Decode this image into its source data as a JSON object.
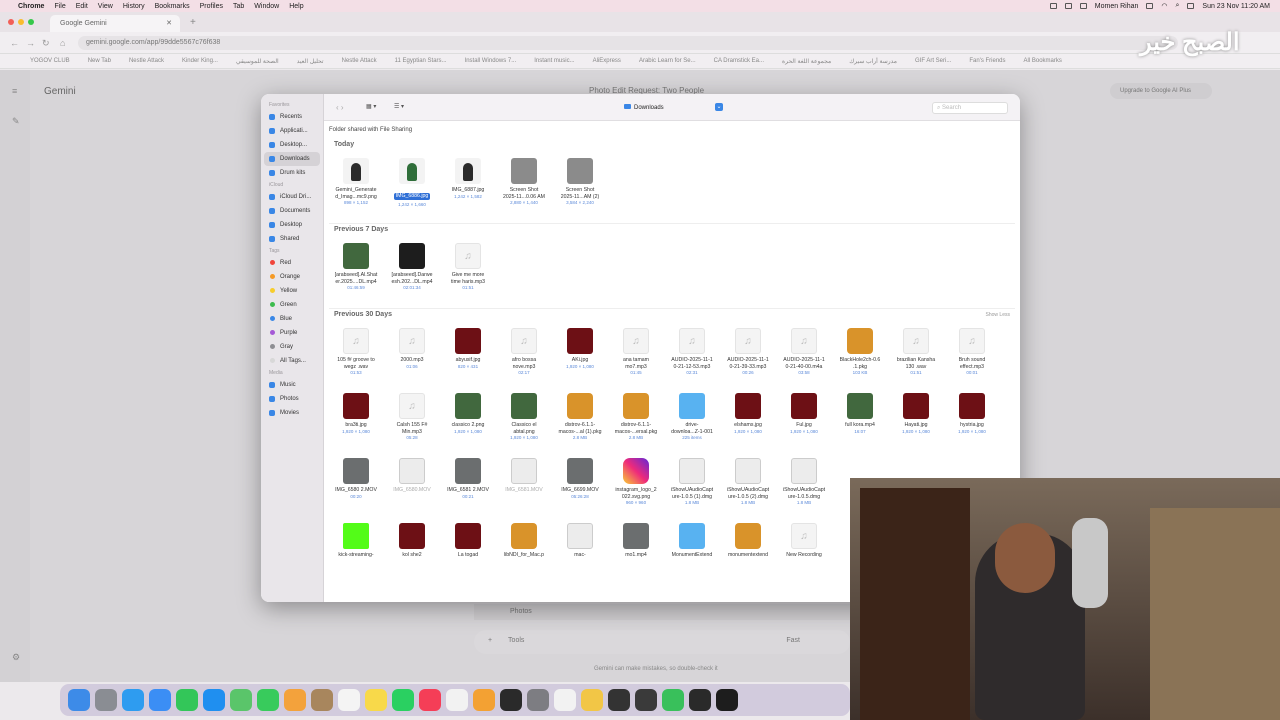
{
  "menubar": {
    "app": "Chrome",
    "items": [
      "File",
      "Edit",
      "View",
      "History",
      "Bookmarks",
      "Profiles",
      "Tab",
      "Window",
      "Help"
    ],
    "user": "Momen Rihan",
    "datetime": "Sun 23 Nov  11:20 AM"
  },
  "browser": {
    "tab_title": "Google Gemini",
    "url": "gemini.google.com/app/99dde5567c76f638",
    "bookmarks": [
      "YOGOV CLUB",
      "New Tab",
      "Nestle Attack",
      "Kinder King...",
      "الصحة للموسيقي",
      "تحليل العيد",
      "Nestle Attack",
      "11 Egyptian Stars...",
      "Install Windows 7...",
      "Instant music...",
      "AliExpress",
      "Arabic Learn for Se...",
      "CA Dramstick Ea...",
      "مجموعة اللغة الحرة",
      "مدرسة أراب سيرك",
      "GIF Art Seri...",
      "Fan's Friends",
      "All Bookmarks"
    ]
  },
  "gemini": {
    "title": "Gemini",
    "chat_title": "Photo Edit Request: Two People",
    "upgrade": "Upgrade to Google AI Plus",
    "photos": "Photos",
    "tools": "Tools",
    "mode": "Fast",
    "disclaimer": "Gemini can make mistakes, so double-check it"
  },
  "watermark": "الصبح خير",
  "finder": {
    "location": "Downloads",
    "search_placeholder": "Search",
    "shared_note": "Folder shared with File Sharing",
    "sidebar": {
      "favorites_header": "Favorites",
      "favorites": [
        "Recents",
        "Applicati...",
        "Desktop...",
        "Downloads",
        "Drum kits"
      ],
      "icloud_header": "iCloud",
      "icloud": [
        "iCloud Dri...",
        "Documents",
        "Desktop",
        "Shared"
      ],
      "tags_header": "Tags",
      "tags": [
        {
          "name": "Red",
          "color": "#f0443a"
        },
        {
          "name": "Orange",
          "color": "#f59a26"
        },
        {
          "name": "Yellow",
          "color": "#f7cd2c"
        },
        {
          "name": "Green",
          "color": "#3dbb4e"
        },
        {
          "name": "Blue",
          "color": "#3a87e6"
        },
        {
          "name": "Purple",
          "color": "#a559d6"
        },
        {
          "name": "Gray",
          "color": "#8e8e93"
        },
        {
          "name": "All Tags...",
          "color": "#d8d8d8"
        }
      ],
      "media_header": "Media",
      "media": [
        "Music",
        "Photos",
        "Movies"
      ]
    },
    "sections": {
      "today": "Today",
      "prev7": "Previous 7 Days",
      "prev30": "Previous 30 Days",
      "show_less": "Show Less"
    },
    "today_items": [
      {
        "name": "Gemini_Generate\nd_Imag...mc9.png",
        "meta": "898 × 1,152",
        "kind": "person"
      },
      {
        "name": "IMG_6886.jpg",
        "meta": "1,242 × 1,660",
        "kind": "person-green",
        "selected": true
      },
      {
        "name": "IMG_6887.jpg",
        "meta": "1,242 × 1,582",
        "kind": "person"
      },
      {
        "name": "Screen Shot\n2025-11...0.06 AM",
        "meta": "2,880 × 1,440",
        "kind": "shot"
      },
      {
        "name": "Screen Shot\n2025-11...AM (2)",
        "meta": "3,584 × 2,240",
        "kind": "shot"
      }
    ],
    "prev7_items": [
      {
        "name": "[arabseed].Al.Shat\ner.2025....DL.mp4",
        "meta": "01:46:59",
        "kind": "green"
      },
      {
        "name": "[arabseed].Darwe\nesh.202...DL.mp4",
        "meta": "02:01:34",
        "kind": "dark"
      },
      {
        "name": "Give me more\ntime haris.mp3",
        "meta": "01:51",
        "kind": "audio"
      }
    ],
    "prev30_rows": [
      [
        {
          "name": "105 f# groove to\nwegz .wav",
          "meta": "01:53",
          "kind": "audio"
        },
        {
          "name": "2000.mp3",
          "meta": "01:06",
          "kind": "audio"
        },
        {
          "name": "abyusif.jpg",
          "meta": "820 × 431",
          "kind": "red"
        },
        {
          "name": "afro bossa\nnove.mp3",
          "meta": "02:17",
          "kind": "audio"
        },
        {
          "name": "AKi.jpg",
          "meta": "1,920 × 1,080",
          "kind": "red"
        },
        {
          "name": "ana tamam\nmo7.mp3",
          "meta": "01:45",
          "kind": "audio"
        },
        {
          "name": "AUDIO-2025-11-1\n0-21-12-53.mp3",
          "meta": "02:31",
          "kind": "audio"
        },
        {
          "name": "AUDIO-2025-11-1\n0-21-39-33.mp3",
          "meta": "00:26",
          "kind": "audio"
        },
        {
          "name": "AUDIO-2025-11-1\n0-21-40-00.m4a",
          "meta": "03:58",
          "kind": "audio"
        },
        {
          "name": "BlackHole2ch-0.6\n.1.pkg",
          "meta": "103 KB",
          "kind": "pkg"
        },
        {
          "name": "brazilian Kansha\n130 .wav",
          "meta": "01:51",
          "kind": "audio"
        },
        {
          "name": "Bruh sound\neffect.mp3",
          "meta": "00:01",
          "kind": "audio"
        }
      ],
      [
        {
          "name": "bra3ti.jpg",
          "meta": "1,920 × 1,080",
          "kind": "red"
        },
        {
          "name": "Calsh 155 F#\nMin.mp3",
          "meta": "05:28",
          "kind": "audio"
        },
        {
          "name": "classico 2.png",
          "meta": "1,920 × 1,080",
          "kind": "green"
        },
        {
          "name": "Classico el\nabtal.png",
          "meta": "1,920 × 1,080",
          "kind": "green"
        },
        {
          "name": "distrov-6.1.1-\nmacos-...al (1).pkg",
          "meta": "2.8 MB",
          "kind": "pkg"
        },
        {
          "name": "distrov-6.1.1-\nmacos-...ersal.pkg",
          "meta": "2.8 MB",
          "kind": "pkg"
        },
        {
          "name": "drive-\ndownloa...Z-1-001",
          "meta": "225 items",
          "kind": "folder"
        },
        {
          "name": "elshams.jpg",
          "meta": "1,920 × 1,080",
          "kind": "red"
        },
        {
          "name": "Ful.jpg",
          "meta": "1,920 × 1,080",
          "kind": "red"
        },
        {
          "name": "full kora.mp4",
          "meta": "16:07",
          "kind": "green"
        },
        {
          "name": "Hayati.jpg",
          "meta": "1,920 × 1,080",
          "kind": "red"
        },
        {
          "name": "hystria.jpg",
          "meta": "1,920 × 1,080",
          "kind": "red"
        }
      ],
      [
        {
          "name": "IMG_6580 2.MOV",
          "meta": "00:20",
          "kind": "photo"
        },
        {
          "name": "IMG_6580.MOV",
          "meta": "",
          "kind": "dmg",
          "dim": true
        },
        {
          "name": "IMG_6581 2.MOV",
          "meta": "00:21",
          "kind": "photo"
        },
        {
          "name": "IMG_6581.MOV",
          "meta": "",
          "kind": "dmg",
          "dim": true
        },
        {
          "name": "IMG_6699.MOV",
          "meta": "05:26:28",
          "kind": "photo"
        },
        {
          "name": "instagram_logo_2\n022.svg.png",
          "meta": "960 × 960",
          "kind": "insta"
        },
        {
          "name": "iShowUAudioCapt\nure-1.0.5 (1).dmg",
          "meta": "1.8 MB",
          "kind": "dmg"
        },
        {
          "name": "iShowUAudioCapt\nure-1.0.5 (2).dmg",
          "meta": "1.8 MB",
          "kind": "dmg"
        },
        {
          "name": "iShowUAudioCapt\nure-1.0.5.dmg",
          "meta": "1.8 MB",
          "kind": "dmg"
        }
      ],
      [
        {
          "name": "kick-streaming-",
          "meta": "",
          "kind": "kick"
        },
        {
          "name": "kol she2",
          "meta": "",
          "kind": "red"
        },
        {
          "name": "La togad",
          "meta": "",
          "kind": "red"
        },
        {
          "name": "libNDI_for_Mac.p",
          "meta": "",
          "kind": "pkg"
        },
        {
          "name": "mac-",
          "meta": "",
          "kind": "dmg"
        },
        {
          "name": "mo1.mp4",
          "meta": "",
          "kind": "photo"
        },
        {
          "name": "MonumentExtend",
          "meta": "",
          "kind": "folder"
        },
        {
          "name": "monumentextend",
          "meta": "",
          "kind": "pkg"
        },
        {
          "name": "New Recording",
          "meta": "",
          "kind": "audio"
        }
      ]
    ]
  },
  "dock": {
    "apps": [
      {
        "name": "Finder",
        "color": "#3d8be8"
      },
      {
        "name": "Launchpad",
        "color": "#8a8d93"
      },
      {
        "name": "Safari",
        "color": "#2e9cf0"
      },
      {
        "name": "Mail",
        "color": "#3b8ef5"
      },
      {
        "name": "FaceTime",
        "color": "#33c659"
      },
      {
        "name": "App Store",
        "color": "#1f8ff0"
      },
      {
        "name": "Maps",
        "color": "#5ac56a"
      },
      {
        "name": "Messages",
        "color": "#38cb5c"
      },
      {
        "name": "Photos",
        "color": "#f3a23c"
      },
      {
        "name": "Contacts",
        "color": "#a8865d"
      },
      {
        "name": "Calendar",
        "color": "#f4f4f4"
      },
      {
        "name": "Notes",
        "color": "#f8d94a"
      },
      {
        "name": "WhatsApp",
        "color": "#2ad061"
      },
      {
        "name": "Music",
        "color": "#f53e57"
      },
      {
        "name": "Reminders",
        "color": "#f2f2f2"
      },
      {
        "name": "Pages",
        "color": "#f3a133"
      },
      {
        "name": "Logic",
        "color": "#2a2a2a"
      },
      {
        "name": "Settings",
        "color": "#7d7d82"
      },
      {
        "name": "Chrome",
        "color": "#f2f2f2"
      },
      {
        "name": "Script",
        "color": "#f2c646"
      },
      {
        "name": "Terminal",
        "color": "#333"
      },
      {
        "name": "OBS",
        "color": "#3a3a3a"
      },
      {
        "name": "Audio",
        "color": "#39c05b"
      },
      {
        "name": "Camo",
        "color": "#2a2a2a"
      },
      {
        "name": "Terminal2",
        "color": "#1d1d1d"
      }
    ]
  },
  "colors": {
    "accent": "#3a87e6",
    "selection": "#2f6fd6",
    "dock_bg": "#c8bed7"
  }
}
